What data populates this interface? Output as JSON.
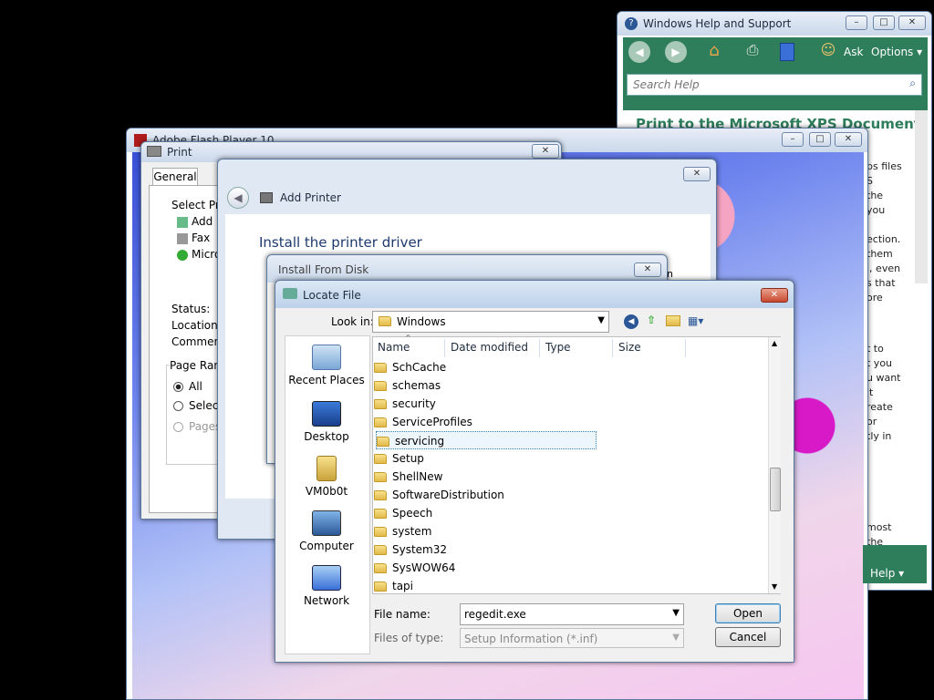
{
  "help": {
    "title": "Windows Help and Support",
    "search_placeholder": "Search Help",
    "ask_label": "Ask",
    "options_label": "Options",
    "heading": "Print to the Microsoft XPS Document",
    "fragments": [
      "ps files",
      "S",
      "the",
      "you",
      "ection.",
      "them",
      "l, even",
      "s that",
      "ore",
      "t to",
      "t you",
      "u want",
      "it",
      "reate",
      "or",
      "tly in",
      "most",
      "the"
    ],
    "help_label": "Help"
  },
  "flash": {
    "title": "Adobe Flash Player 10"
  },
  "print": {
    "title": "Print",
    "tab_general": "General",
    "select_printer": "Select Prin",
    "printers": [
      "Add P",
      "Fax",
      "Micro"
    ],
    "status_label": "Status:",
    "location_label": "Location:",
    "comment_label": "Comment:",
    "page_range": "Page Rang",
    "all": "All",
    "selection": "Selecti",
    "pages": "Pages"
  },
  "add_printer": {
    "title": "Add Printer",
    "heading": "Install the printer driver"
  },
  "install_disk": {
    "title": "Install From Disk",
    "fragment": "n"
  },
  "locate": {
    "title": "Locate File",
    "look_in_label": "Look in:",
    "look_in_value": "Windows",
    "columns": [
      "Name",
      "Date modified",
      "Type",
      "Size"
    ],
    "places": [
      "Recent Places",
      "Desktop",
      "VM0b0t",
      "Computer",
      "Network"
    ],
    "files": [
      "SchCache",
      "schemas",
      "security",
      "ServiceProfiles",
      "servicing",
      "Setup",
      "ShellNew",
      "SoftwareDistribution",
      "Speech",
      "system",
      "System32",
      "SysWOW64",
      "tapi"
    ],
    "selected_index": 4,
    "file_name_label": "File name:",
    "file_name_value": "regedit.exe",
    "files_of_type_label": "Files of type:",
    "files_of_type_value": "Setup Information (*.inf)",
    "open_label": "Open",
    "cancel_label": "Cancel"
  },
  "colors": {
    "help_green": "#2e7d5b",
    "accent": "#3c7fb1"
  }
}
